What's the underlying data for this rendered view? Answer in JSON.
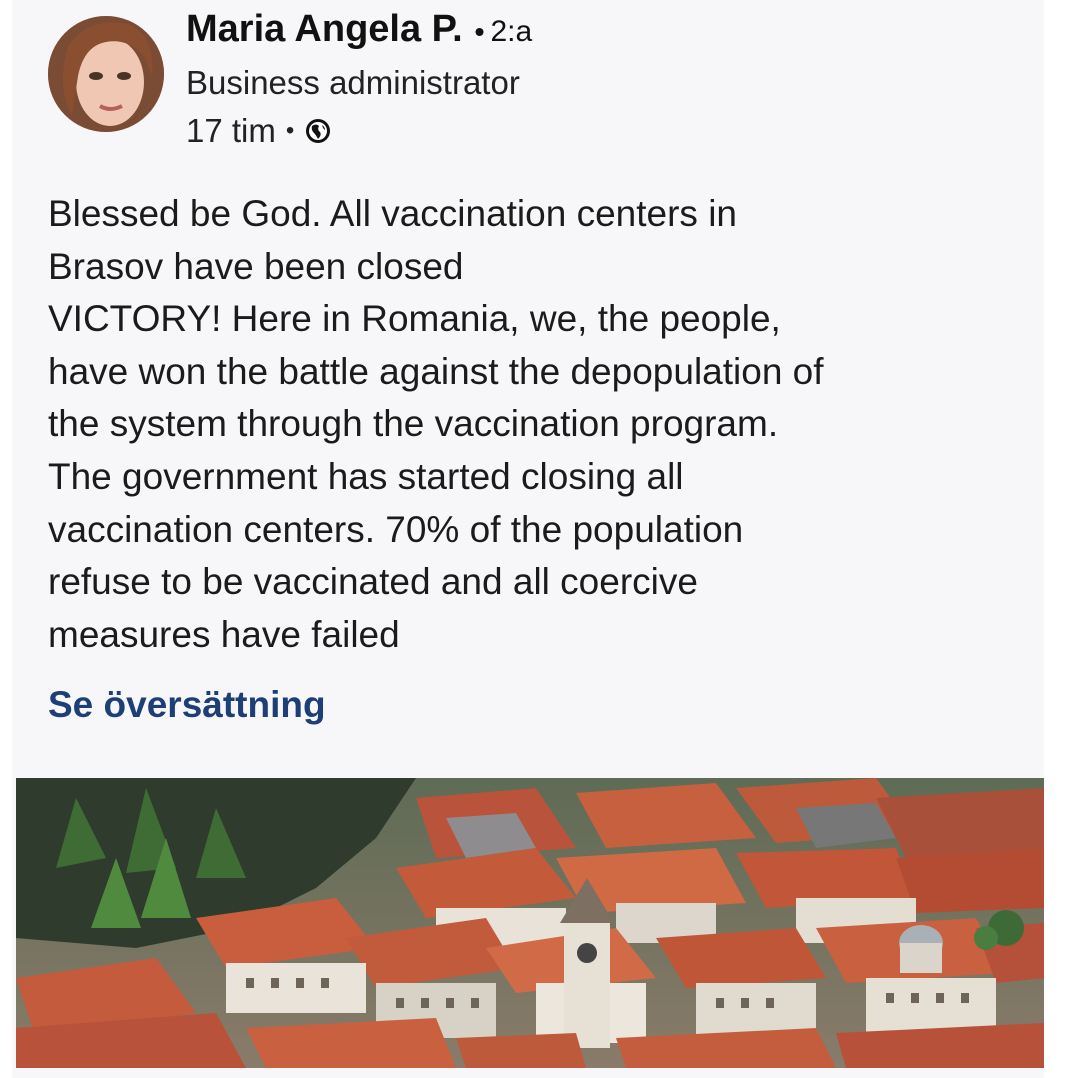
{
  "post": {
    "author": {
      "name": "Maria Angela P.",
      "separator": "•",
      "degree": "2:a",
      "title": "Business administrator"
    },
    "meta": {
      "time": "17 tim",
      "separator": "•",
      "visibility_icon": "globe-icon"
    },
    "text_lines": [
      "Blessed be God. All vaccination centers in",
      "Brasov have been closed",
      "VICTORY! Here in Romania, we, the people,",
      "have won the battle against the depopulation of",
      "the system through the vaccination program.",
      "The government has started closing all",
      "vaccination centers. 70% of the population",
      "refuse to be vaccinated and all coercive",
      "measures have failed"
    ],
    "translate_label": "Se översättning"
  },
  "colors": {
    "link": "#1d3f75",
    "card_bg": "#f7f6f8",
    "roof": "#c2553a"
  }
}
